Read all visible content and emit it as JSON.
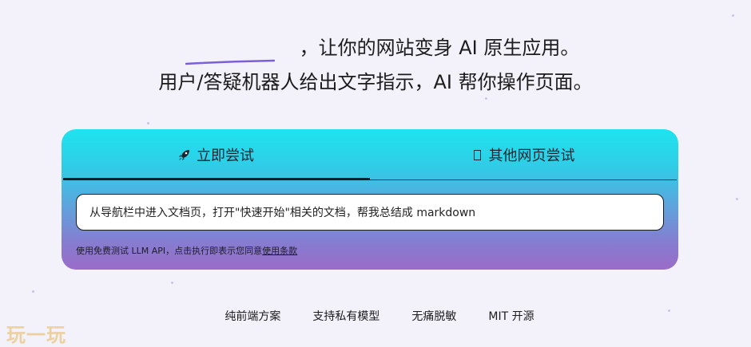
{
  "hero": {
    "line1": "，让你的网站变身 AI 原生应用。",
    "line2": "用户/答疑机器人给出文字指示，AI 帮你操作页面。"
  },
  "tabs": [
    {
      "label": "立即尝试",
      "icon": "rocket-icon",
      "active": true
    },
    {
      "label": "其他网页尝试",
      "icon": "box-icon",
      "active": false
    }
  ],
  "task_input": {
    "value": "从导航栏中进入文档页，打开\"快速开始\"相关的文档，帮我总结成 markdown"
  },
  "terms": {
    "prefix": "使用免费测试 LLM API，点击执行即表示您同意",
    "link": "使用条款"
  },
  "features": [
    "纯前端方案",
    "支持私有模型",
    "无痛脱敏",
    "MIT 开源"
  ],
  "watermark": "玩一玩",
  "colors": {
    "card_top": "#1ee4ee",
    "card_bottom": "#9a6cc9",
    "underline": "#7b5fd6"
  }
}
